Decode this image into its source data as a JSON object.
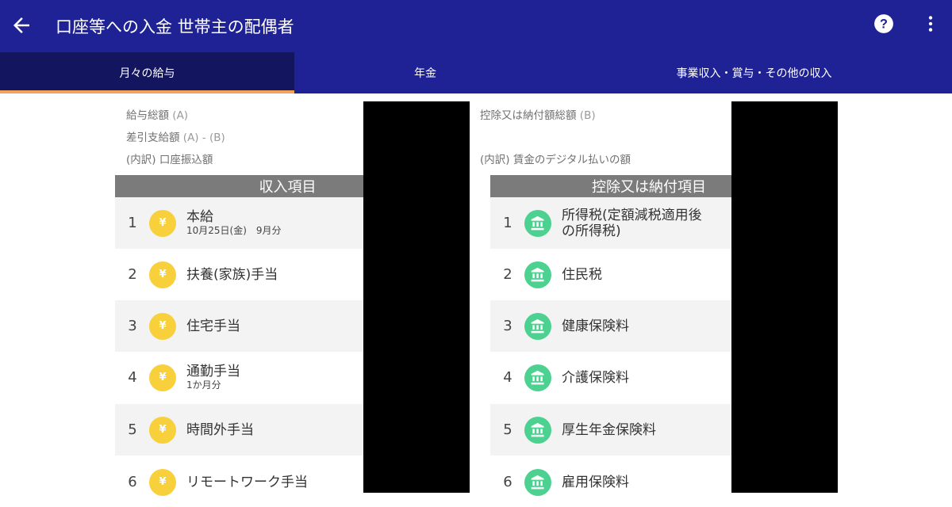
{
  "app": {
    "title": "口座等への入金 世帯主の配偶者"
  },
  "toolbar": {
    "back_icon": "arrow-left-icon",
    "help_icon": "help-circle-icon",
    "more_icon": "more-vertical-icon"
  },
  "tabs": [
    {
      "label": "月々の給与",
      "active": true
    },
    {
      "label": "年金",
      "active": false
    },
    {
      "label": "事業収入・賞与・その他の収入",
      "active": false
    }
  ],
  "summary": {
    "gross_pay_label": "給与総額",
    "gross_pay_tag": "(A)",
    "net_pay_label": "差引支給額",
    "net_pay_tag": "(A) - (B)",
    "bank_transfer_label": "(内訳) 口座振込額",
    "deductions_total_label": "控除又は納付額総額",
    "deductions_total_tag": "(B)",
    "digital_pay_label": "(内訳) 賃金のデジタル払いの額"
  },
  "income": {
    "header": "収入項目",
    "items": [
      {
        "num": "1",
        "name": "本給",
        "sub": "10月25日(金)　9月分",
        "icon": "yen-icon"
      },
      {
        "num": "2",
        "name": "扶養(家族)手当",
        "sub": "",
        "icon": "yen-icon"
      },
      {
        "num": "3",
        "name": "住宅手当",
        "sub": "",
        "icon": "yen-icon"
      },
      {
        "num": "4",
        "name": "通勤手当",
        "sub": "1か月分",
        "icon": "yen-icon"
      },
      {
        "num": "5",
        "name": "時間外手当",
        "sub": "",
        "icon": "yen-icon"
      },
      {
        "num": "6",
        "name": "リモートワーク手当",
        "sub": "",
        "icon": "yen-icon"
      }
    ]
  },
  "deductions": {
    "header": "控除又は納付項目",
    "items": [
      {
        "num": "1",
        "name": "所得税(定額減税適用後の所得税)",
        "name_line1": "所得税(定額減税適用後",
        "name_line2": "の所得税)",
        "icon": "bank-icon"
      },
      {
        "num": "2",
        "name": "住民税",
        "icon": "bank-icon"
      },
      {
        "num": "3",
        "name": "健康保険料",
        "icon": "bank-icon"
      },
      {
        "num": "4",
        "name": "介護保険料",
        "icon": "bank-icon"
      },
      {
        "num": "5",
        "name": "厚生年金保険料",
        "icon": "bank-icon"
      },
      {
        "num": "6",
        "name": "雇用保険料",
        "icon": "bank-icon"
      }
    ]
  },
  "colors": {
    "appbar": "#1f2295",
    "active_tab": "#13155e",
    "tab_indicator": "#f0a35a",
    "yen_icon": "#f7d03b",
    "bank_icon": "#4cd190",
    "section_header": "#7b7b7b"
  }
}
